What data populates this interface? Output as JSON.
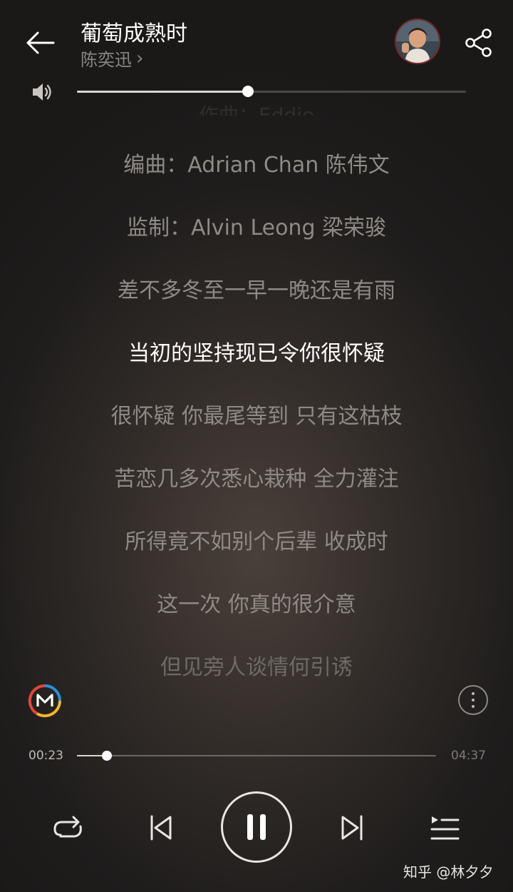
{
  "header": {
    "title": "葡萄成熟时",
    "artist": "陈奕迅",
    "artist_chevron": "›",
    "icons": {
      "back": "arrow-left-icon",
      "share": "share-icon",
      "avatar": "artist-avatar"
    }
  },
  "volume": {
    "icon": "speaker-icon",
    "level": 0.44
  },
  "lyrics": {
    "faded_line": "作曲：Eddie",
    "lines": [
      "编曲：Adrian Chan 陈伟文",
      "监制：Alvin Leong 梁荣骏",
      "差不多冬至一早一晚还是有雨",
      "当初的坚持现已令你很怀疑",
      "很怀疑 你最尾等到 只有这枯枝",
      "苦恋几多次悉心栽种 全力灌注",
      "所得竟不如别个后辈 收成时",
      "这一次 你真的很介意",
      "但见旁人谈情何引诱"
    ],
    "active_index": 3
  },
  "tools": {
    "logo_icon": "m-logo-icon",
    "more_icon": "more-vertical-icon"
  },
  "progress": {
    "current_time": "00:23",
    "total_time": "04:37",
    "fraction": 0.083
  },
  "controls": {
    "repeat_icon": "repeat-icon",
    "prev_icon": "skip-previous-icon",
    "pause_icon": "pause-icon",
    "next_icon": "skip-next-icon",
    "playlist_icon": "playlist-icon"
  },
  "colors": {
    "background": "#2a2623",
    "active_lyric": "#ffffff",
    "inactive_lyric": "#8e8a86",
    "logo_red": "#e0473a",
    "logo_blue": "#2a8fd6",
    "logo_yellow": "#f2b52a"
  },
  "watermark": "知乎 @林夕夕"
}
